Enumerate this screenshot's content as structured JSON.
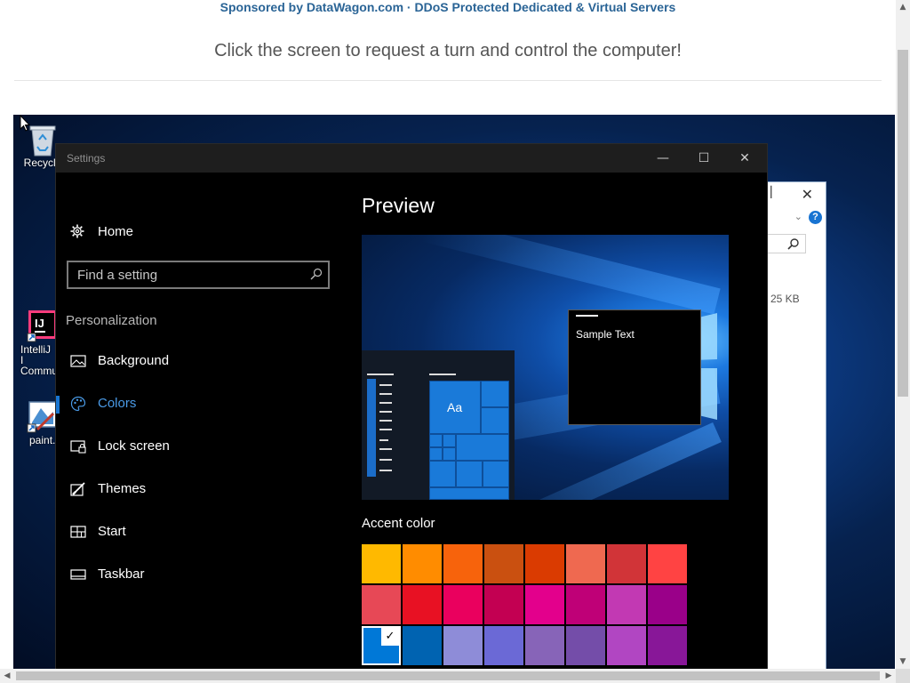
{
  "host_page": {
    "sponsor": "Sponsored by DataWagon.com · DDoS Protected Dedicated & Virtual Servers",
    "instruction": "Click the screen to request a turn and control the computer!"
  },
  "desktop": {
    "icons": [
      {
        "label": "Recycle",
        "icon": "recycle-bin-icon"
      },
      {
        "label": "IntelliJ I Commu",
        "icon": "intellij-idea-icon"
      },
      {
        "label": "paint.n",
        "icon": "paint-icon"
      }
    ]
  },
  "explorer_window": {
    "size_text": "25 KB",
    "help": "?"
  },
  "settings": {
    "title": "Settings",
    "window_controls": {
      "minimize": "—",
      "maximize": "☐",
      "close": "✕"
    },
    "home_label": "Home",
    "search_placeholder": "Find a setting",
    "section_title": "Personalization",
    "nav": [
      {
        "label": "Background",
        "icon": "picture-icon",
        "active": false
      },
      {
        "label": "Colors",
        "icon": "palette-icon",
        "active": true
      },
      {
        "label": "Lock screen",
        "icon": "lock-screen-icon",
        "active": false
      },
      {
        "label": "Themes",
        "icon": "themes-brush-icon",
        "active": false
      },
      {
        "label": "Start",
        "icon": "start-menu-icon",
        "active": false
      },
      {
        "label": "Taskbar",
        "icon": "taskbar-icon",
        "active": false
      }
    ],
    "preview": {
      "title": "Preview",
      "tile_label": "Aa",
      "sample_text": "Sample Text"
    },
    "accent": {
      "title": "Accent color",
      "selected_index": 16,
      "selected_mark": "✓",
      "colors": [
        "#FFB900",
        "#FF8C00",
        "#F7630C",
        "#CA5010",
        "#DA3B01",
        "#EF6950",
        "#D13438",
        "#FF4343",
        "#E74856",
        "#E81123",
        "#EA005E",
        "#C30052",
        "#E3008C",
        "#BF0077",
        "#C239B3",
        "#9A0089",
        "#0078D7",
        "#0063B1",
        "#8E8CD8",
        "#6B69D6",
        "#8764B8",
        "#744DA9",
        "#B146C2",
        "#881798"
      ]
    }
  },
  "colors": {
    "accent": "#0078D7",
    "active_nav": "#4A9AE6",
    "sponsor_link": "#2A6496"
  }
}
